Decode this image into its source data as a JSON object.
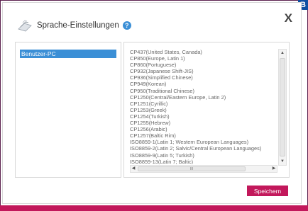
{
  "badge": {
    "letter": "B"
  },
  "dialog": {
    "title": "Sprache-Einstellungen",
    "help_icon": "help-icon",
    "close_icon": "close-icon",
    "close_glyph": "X"
  },
  "left_pane": {
    "items": [
      "Benutzer-PC"
    ]
  },
  "right_pane": {
    "items": [
      "CP437(United States, Canada)",
      "CP850(Europe, Latin 1)",
      "CP860(Portuguese)",
      "CP932(Japanese Shift-JIS)",
      "CP936(Simplified Chinese)",
      "CP949(Korean)",
      "CP950(Traditional Chinese)",
      "CP1250(Central/Eastern Europe, Latin 2)",
      "CP1251(Cyrillic)",
      "CP1253(Greek)",
      "CP1254(Turkish)",
      "CP1255(Hebrew)",
      "CP1256(Arabic)",
      "CP1257(Baltic Rim)",
      "ISO8859-1(Latin 1; Western European Languages)",
      "ISO8859-2(Latin 2; Salvic/Central European Languages)",
      "ISO8859-9(Latin 5; Turkish)",
      "ISO8859-13(Latin 7; Baltic)"
    ],
    "scroll_thumb_label": "III"
  },
  "actions": {
    "save_label": "Speichern"
  },
  "colors": {
    "accent": "#c2185b",
    "selection": "#3b8fd6",
    "badge": "#0d4fa3"
  }
}
